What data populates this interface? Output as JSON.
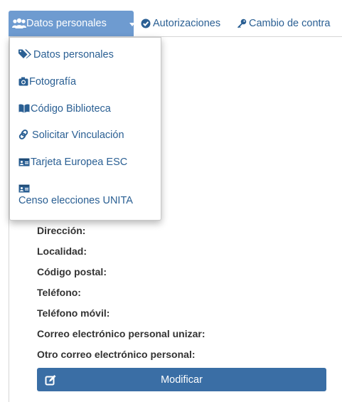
{
  "nav": {
    "active_tab": "Datos personales",
    "tabs": [
      {
        "label": "Autorizaciones",
        "icon": "check-circle-icon"
      },
      {
        "label": "Cambio de contra",
        "icon": "key-icon"
      }
    ]
  },
  "dropdown": {
    "items": [
      {
        "label": "Datos personales",
        "icon": "tags-icon"
      },
      {
        "label": "Fotografía",
        "icon": "camera-icon"
      },
      {
        "label": "Código Biblioteca",
        "icon": "book-icon"
      },
      {
        "label": "Solicitar Vinculación",
        "icon": "link-icon"
      },
      {
        "label": "Tarjeta Europea ESC",
        "icon": "id-card-icon"
      },
      {
        "label": "Censo elecciones UNITA",
        "icon": "id-card-icon"
      }
    ]
  },
  "fields": [
    "Dirección:",
    "Localidad:",
    "Código postal:",
    "Teléfono:",
    "Teléfono móvil:",
    "Correo electrónico personal unizar:",
    "Otro correo electrónico personal:"
  ],
  "modify_button": {
    "label": "Modificar",
    "icon": "edit-icon"
  },
  "colors": {
    "accent": "#6e9bd0",
    "link": "#2a5f93",
    "button": "#3a6ea5"
  }
}
